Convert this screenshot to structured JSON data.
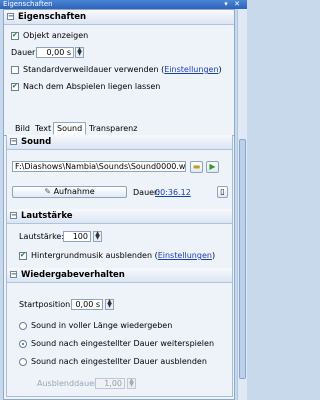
{
  "window": {
    "title": "Eigenschaften"
  },
  "properties": {
    "header": "Eigenschaften",
    "object_show": "Objekt anzeigen",
    "duration_label": "Dauer:",
    "duration_value": "0,00 s",
    "standard_duration_text": "Standardverweildauer verwenden (",
    "settings_link": "Einstellungen",
    "close_paren": ")",
    "after_play": "Nach dem Abspielen liegen lassen"
  },
  "tabs": [
    "Bild",
    "Text",
    "Sound",
    "Transparenz"
  ],
  "sound": {
    "header": "Sound",
    "path": "F:\\Diashows\\Nambia\\Sounds\\Sound0000.w",
    "record_label": "Aufnahme",
    "duration_label": "Dauer:",
    "duration_value": "00:36.12"
  },
  "volume": {
    "header": "Lautstärke",
    "label": "Lautstärke:",
    "value": "100 %",
    "hide_bg_text": "Hintergrundmusik ausblenden (",
    "settings_link": "Einstellungen",
    "close_paren": ")"
  },
  "playback": {
    "header": "Wiedergabeverhalten",
    "start_label": "Startposition:",
    "start_value": "0,00 s",
    "opt_full": "Sound in voller Länge wiedergeben",
    "opt_continue": "Sound nach eingestellter Dauer weiterspielen",
    "opt_fadeout": "Sound nach eingestellter Dauer ausblenden",
    "fade_label": "Ausblenddauer:",
    "fade_value": "1,00 s"
  }
}
